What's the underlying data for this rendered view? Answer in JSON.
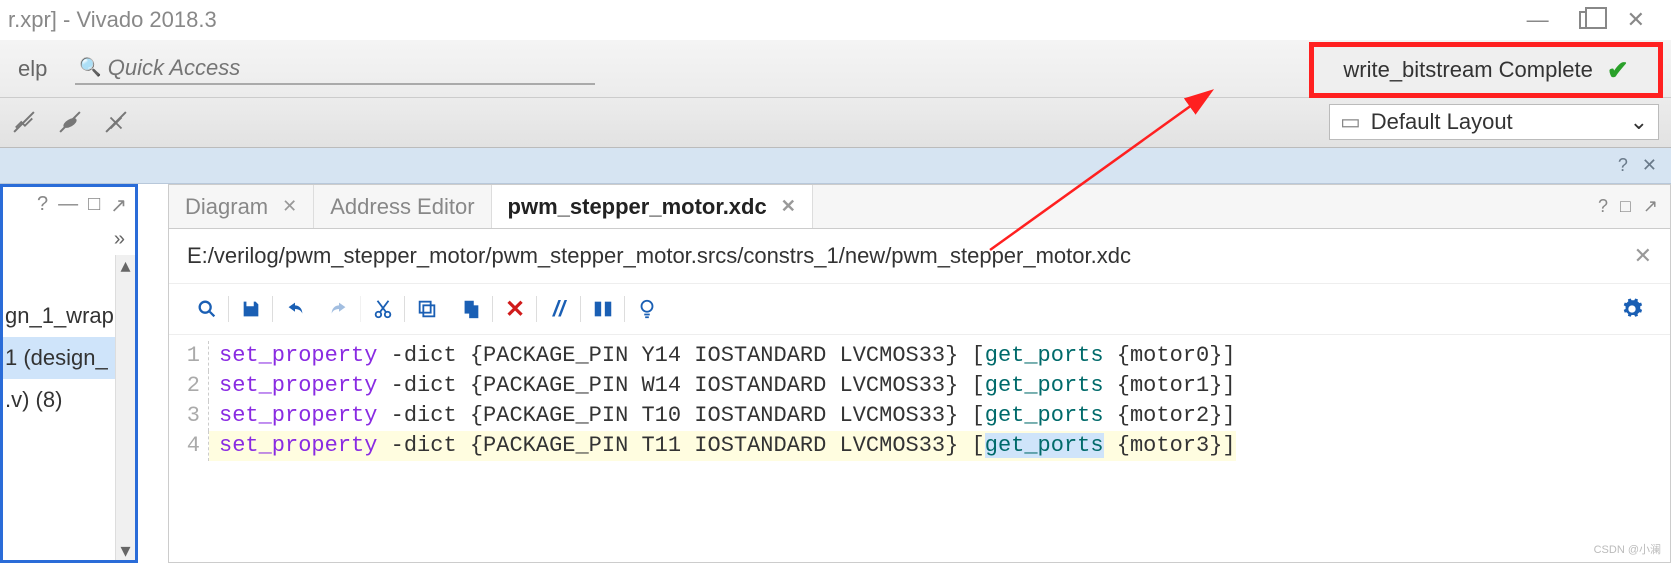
{
  "title": "r.xpr] - Vivado 2018.3",
  "menu": {
    "help": "elp"
  },
  "search": {
    "placeholder": "Quick Access"
  },
  "status": {
    "text": "write_bitstream Complete"
  },
  "layout": {
    "label": "Default Layout"
  },
  "left_panel": {
    "items": [
      "gn_1_wrap",
      "1 (design_",
      ".v) (8)"
    ],
    "selected_index": 1
  },
  "tabs": [
    {
      "label": "Diagram",
      "active": false
    },
    {
      "label": "Address Editor",
      "active": false
    },
    {
      "label": "pwm_stepper_motor.xdc",
      "active": true
    }
  ],
  "file_path": "E:/verilog/pwm_stepper_motor/pwm_stepper_motor.srcs/constrs_1/new/pwm_stepper_motor.xdc",
  "code": [
    {
      "n": 1,
      "cmd": "set_property",
      "opts": " -dict {PACKAGE_PIN Y14 IOSTANDARD LVCMOS33} [",
      "get": "get_ports",
      "port": " {motor0}]"
    },
    {
      "n": 2,
      "cmd": "set_property",
      "opts": " -dict {PACKAGE_PIN W14 IOSTANDARD LVCMOS33} [",
      "get": "get_ports",
      "port": " {motor1}]"
    },
    {
      "n": 3,
      "cmd": "set_property",
      "opts": " -dict {PACKAGE_PIN T10 IOSTANDARD LVCMOS33} [",
      "get": "get_ports",
      "port": " {motor2}]"
    },
    {
      "n": 4,
      "cmd": "set_property",
      "opts": " -dict {PACKAGE_PIN T11 IOSTANDARD LVCMOS33} [",
      "get": "get_ports",
      "port": " {motor3}]",
      "hl": true
    }
  ],
  "watermark": "CSDN @小澜"
}
